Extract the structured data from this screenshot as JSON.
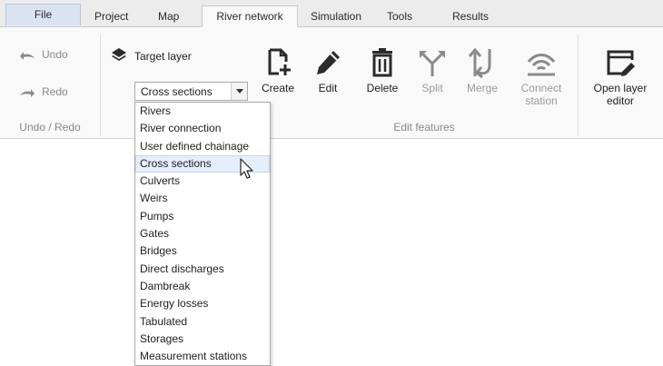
{
  "tabs": [
    {
      "label": "File"
    },
    {
      "label": "Project"
    },
    {
      "label": "Map"
    },
    {
      "label": "River network"
    },
    {
      "label": "Simulation"
    },
    {
      "label": "Tools"
    },
    {
      "label": "Results"
    }
  ],
  "active_tab": "River network",
  "undo_group": {
    "undo_label": "Undo",
    "redo_label": "Redo",
    "group_label": "Undo / Redo"
  },
  "edit_group": {
    "target_layer_label": "Target layer",
    "selected_layer": "Cross sections",
    "buttons": [
      {
        "label": "Create",
        "icon": "create-doc-icon",
        "enabled": true
      },
      {
        "label": "Edit",
        "icon": "pencil-icon",
        "enabled": true
      },
      {
        "label": "Delete",
        "icon": "trash-icon",
        "enabled": true
      },
      {
        "label": "Split",
        "icon": "split-icon",
        "enabled": false
      },
      {
        "label": "Merge",
        "icon": "merge-icon",
        "enabled": false
      },
      {
        "label": "Connect station",
        "icon": "wifi-station-icon",
        "enabled": false
      }
    ],
    "group_label": "Edit features"
  },
  "layer_editor": {
    "label": "Open layer editor",
    "icon": "layer-editor-icon"
  },
  "dropdown_items": [
    "Rivers",
    "River connection",
    "User defined chainage",
    "Cross sections",
    "Culverts",
    "Weirs",
    "Pumps",
    "Gates",
    "Bridges",
    "Direct discharges",
    "Dambreak",
    "Energy losses",
    "Tabulated",
    "Storages",
    "Measurement stations"
  ],
  "hovered_item": "Cross sections",
  "colors": {
    "file_tab_bg": "#d9e3f2",
    "hover_bg": "#e5eefb",
    "icon_dark": "#2b2b2b",
    "disabled_text": "#9a9a9a"
  }
}
